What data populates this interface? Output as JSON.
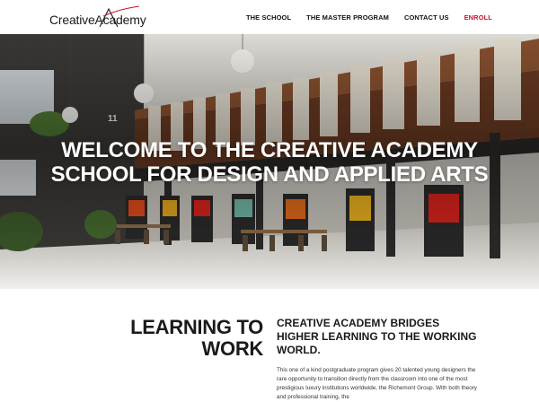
{
  "header": {
    "logo_text": "CreativeAcademy",
    "nav": {
      "school": "THE SCHOOL",
      "master": "THE MASTER PROGRAM",
      "contact": "CONTACT US",
      "enroll": "ENROLL"
    }
  },
  "hero": {
    "title_line1": "WELCOME TO THE CREATIVE ACADEMY",
    "title_line2": "SCHOOL FOR DESIGN AND APPLIED ARTS",
    "room_number": "11"
  },
  "intro": {
    "heading_line1": "LEARNING TO",
    "heading_line2": "WORK",
    "subheading": "CREATIVE ACADEMY BRIDGES HIGHER LEARNING TO THE WORKING WORLD.",
    "body": "This one of a kind postgraduate program gives 20 talented young designers the rare opportunity to transition directly from the classroom into one of the most prestigious luxury institutions worldwide, the Richemont Group. With both theory and professional training, the"
  },
  "colors": {
    "accent": "#c8102e",
    "text": "#1a1a1a"
  },
  "icons": {
    "logo": "creative-academy-logo"
  }
}
